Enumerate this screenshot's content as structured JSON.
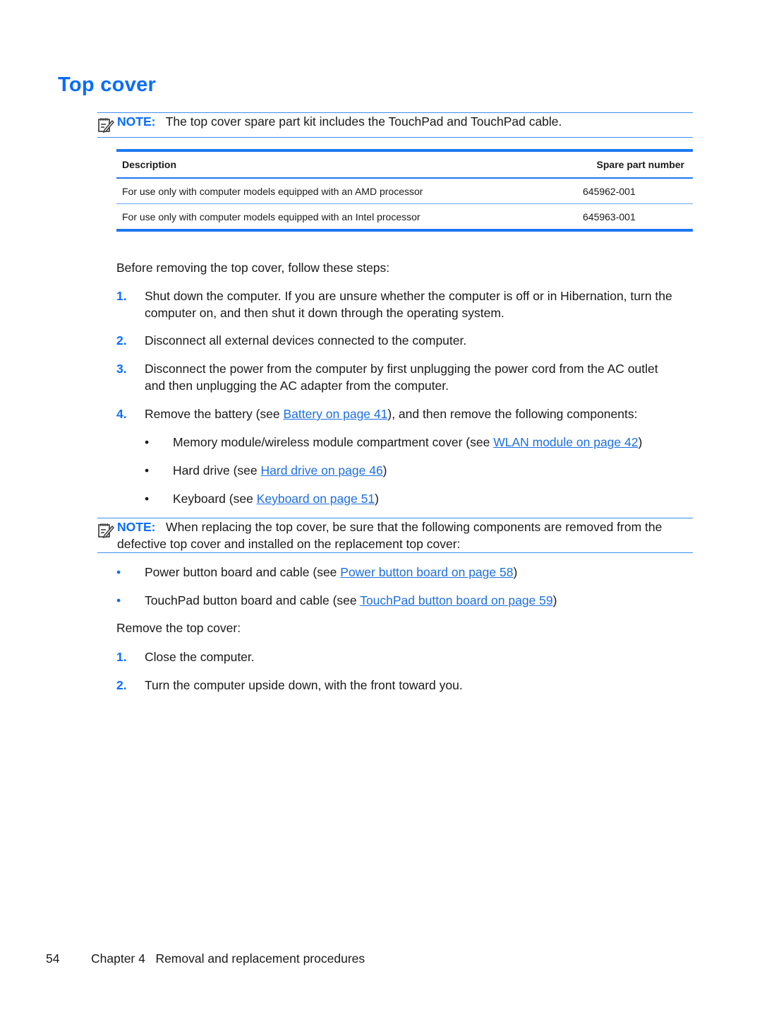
{
  "page": {
    "title": "Top cover",
    "note1": {
      "label": "NOTE:",
      "text": "The top cover spare part kit includes the TouchPad and TouchPad cable."
    },
    "table": {
      "headers": [
        "Description",
        "Spare part number"
      ],
      "rows": [
        [
          "For use only with computer models equipped with an AMD processor",
          "645962-001"
        ],
        [
          "For use only with computer models equipped with an Intel processor",
          "645963-001"
        ]
      ]
    },
    "intro": "Before removing the top cover, follow these steps:",
    "steps": [
      {
        "num": "1.",
        "text": "Shut down the computer. If you are unsure whether the computer is off or in Hibernation, turn the computer on, and then shut it down through the operating system."
      },
      {
        "num": "2.",
        "text": "Disconnect all external devices connected to the computer."
      },
      {
        "num": "3.",
        "text": "Disconnect the power from the computer by first unplugging the power cord from the AC outlet and then unplugging the AC adapter from the computer."
      },
      {
        "num": "4.",
        "pre": "Remove the battery (see ",
        "link": "Battery on page 41",
        "post": "), and then remove the following components:"
      }
    ],
    "components": [
      {
        "pre": "Memory module/wireless module compartment cover (see ",
        "link": "WLAN module on page 42",
        "post": ")"
      },
      {
        "pre": "Hard drive (see ",
        "link": "Hard drive on page 46",
        "post": ")"
      },
      {
        "pre": "Keyboard (see ",
        "link": "Keyboard on page 51",
        "post": ")"
      }
    ],
    "note2": {
      "label": "NOTE:",
      "text": "When replacing the top cover, be sure that the following components are removed from the defective top cover and installed on the replacement top cover:"
    },
    "note2_items": [
      {
        "pre": "Power button board and cable (see ",
        "link": "Power button board on page 58",
        "post": ")"
      },
      {
        "pre": "TouchPad button board and cable (see ",
        "link": "TouchPad button board on page 59",
        "post": ")"
      }
    ],
    "remove_intro": "Remove the top cover:",
    "remove_steps": [
      {
        "num": "1.",
        "text": "Close the computer."
      },
      {
        "num": "2.",
        "text": "Turn the computer upside down, with the front toward you."
      }
    ],
    "bullet_glyph": "•",
    "footer": {
      "page_number": "54",
      "chapter": "Chapter 4   Removal and replacement procedures"
    }
  },
  "colors": {
    "accent": "#0a6cff",
    "link": "#1e6fe0",
    "rule": "#1e78f0"
  }
}
